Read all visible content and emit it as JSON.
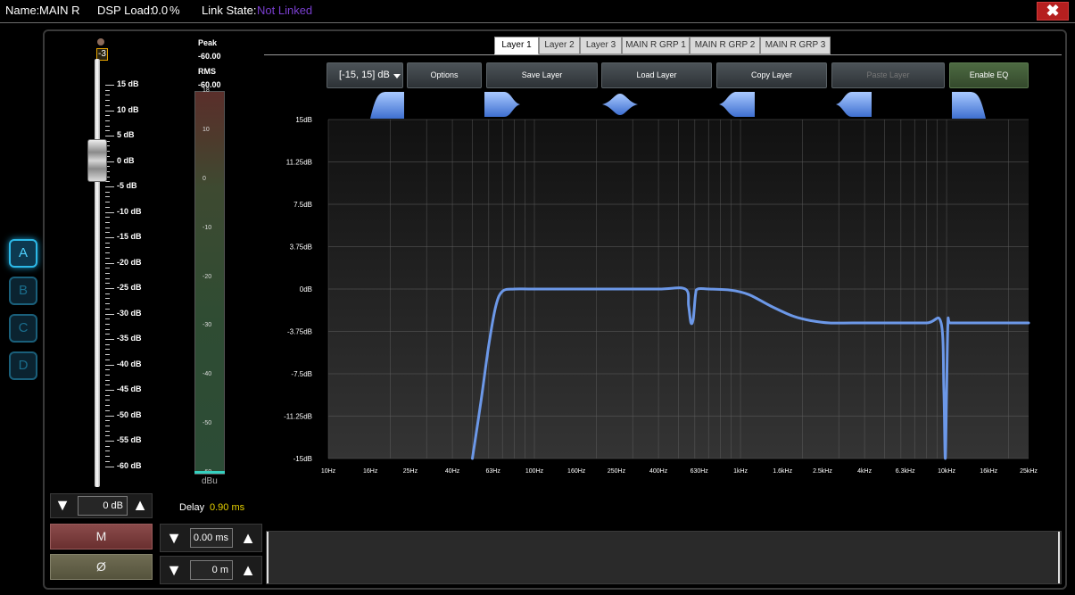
{
  "status": {
    "name_label": "Name:",
    "name_value": "MAIN R",
    "dsp_label": "DSP Load:",
    "dsp_value": "0.0",
    "dsp_unit": "%",
    "link_label": "Link State:",
    "link_value": "Not Linked",
    "link_color": "#7a3fd0",
    "close_glyph": "✖"
  },
  "presets": [
    "A",
    "B",
    "C",
    "D"
  ],
  "fader": {
    "value_badge": "-3",
    "scale": [
      "15 dB",
      "10 dB",
      "5 dB",
      "0 dB",
      "-5 dB",
      "-10 dB",
      "-15 dB",
      "-20 dB",
      "-25 dB",
      "-30 dB",
      "-35 dB",
      "-40 dB",
      "-45 dB",
      "-50 dB",
      "-55 dB",
      "-60 dB"
    ]
  },
  "meter": {
    "peak_label": "Peak",
    "peak_value": "-60.00",
    "rms_label": "RMS",
    "rms_value": "-60.00",
    "scale": [
      "18",
      "10",
      "0",
      "-10",
      "-20",
      "-30",
      "-40",
      "-50",
      "-60"
    ],
    "unit": "dBu"
  },
  "gain": {
    "value": "0 dB",
    "down_glyph": "▼",
    "up_glyph": "▲"
  },
  "buttons": {
    "mute": "M",
    "phase": "Ø"
  },
  "delay": {
    "label": "Delay",
    "value": "0.90 ms",
    "time_value": "0.00 ms",
    "distance_value": "0 m"
  },
  "tabs": [
    {
      "label": "Layer 1",
      "active": true
    },
    {
      "label": "Layer 2",
      "active": false
    },
    {
      "label": "Layer 3",
      "active": false
    },
    {
      "label": "MAIN R GRP 1",
      "active": false
    },
    {
      "label": "MAIN R GRP 2",
      "active": false
    },
    {
      "label": "MAIN R GRP 3",
      "active": false
    }
  ],
  "toolbar": {
    "range": "[-15, 15] dB",
    "options": "Options",
    "save": "Save Layer",
    "load": "Load Layer",
    "copy": "Copy Layer",
    "paste": "Paste Layer",
    "enable_eq": "Enable EQ"
  },
  "bands": [
    {
      "name": "highpass-band-icon",
      "shape": "highpass"
    },
    {
      "name": "lowshelf-band-icon",
      "shape": "lowshelf"
    },
    {
      "name": "peak-band-icon",
      "shape": "peak"
    },
    {
      "name": "notch-band-icon",
      "shape": "notch"
    },
    {
      "name": "highshelf-band-icon",
      "shape": "highshelf"
    },
    {
      "name": "lowpass-band-icon",
      "shape": "lowpass"
    }
  ],
  "chart_data": {
    "type": "line",
    "xscale": "log",
    "xlim": [
      10,
      25000
    ],
    "ylim": [
      -15,
      15
    ],
    "x_ticks": [
      10,
      16,
      25,
      40,
      63,
      100,
      160,
      250,
      400,
      630,
      1000,
      1600,
      2500,
      4000,
      6300,
      10000,
      16000,
      25000
    ],
    "x_tick_labels": [
      "10Hz",
      "16Hz",
      "25Hz",
      "40Hz",
      "63Hz",
      "100Hz",
      "160Hz",
      "250Hz",
      "400Hz",
      "630Hz",
      "1kHz",
      "1.6kHz",
      "2.5kHz",
      "4kHz",
      "6.3kHz",
      "10kHz",
      "16kHz",
      "25kHz"
    ],
    "y_ticks": [
      15,
      11.25,
      7.5,
      3.75,
      0,
      -3.75,
      -7.5,
      -11.25,
      -15
    ],
    "y_tick_labels": [
      "15dB",
      "11.25dB",
      "7.5dB",
      "3.75dB",
      "0dB",
      "-3.75dB",
      "-7.5dB",
      "-11.25dB",
      "-15dB"
    ],
    "grid": true,
    "line_color": "#6c98e8",
    "series": [
      {
        "x": [
          50,
          55,
          60,
          65,
          70,
          80,
          100,
          200,
          400,
          540,
          560,
          575,
          590,
          605,
          620,
          700,
          900,
          1100,
          1400,
          1800,
          2200,
          2700,
          3500,
          5000,
          8000,
          9400,
          9700,
          9850,
          10000,
          10150,
          10400,
          12000,
          16000,
          25000
        ],
        "y": [
          -15,
          -10,
          -5,
          -1.5,
          -0.2,
          0,
          0,
          0,
          0,
          0,
          -1.5,
          -3.0,
          -2.6,
          -0.5,
          0,
          0,
          -0.1,
          -0.5,
          -1.5,
          -2.4,
          -2.8,
          -3.0,
          -3.0,
          -3.0,
          -3.0,
          -3.0,
          -9.0,
          -15,
          -9.0,
          -3.0,
          -3.0,
          -3.0,
          -3.0,
          -3.0
        ]
      }
    ]
  }
}
